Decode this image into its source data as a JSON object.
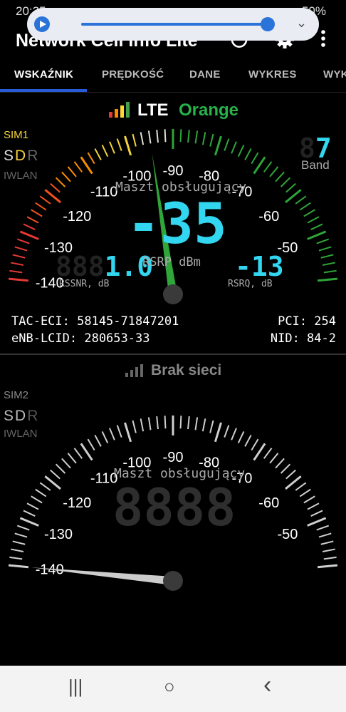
{
  "status": {
    "time": "20:25",
    "battery": "50%"
  },
  "app": {
    "title": "Network Cell Info Lite"
  },
  "icons": {
    "power": "power-icon",
    "settings": "gear-icon",
    "more": "more-vert-icon"
  },
  "tabs": [
    {
      "label": "WSKAŹNIK",
      "active": true
    },
    {
      "label": "PRĘDKOŚĆ",
      "active": false
    },
    {
      "label": "DANE",
      "active": false
    },
    {
      "label": "WYKRES",
      "active": false
    },
    {
      "label": "WYK",
      "active": false
    }
  ],
  "sim1": {
    "tech": "LTE",
    "operator": "Orange",
    "label": "SIM1",
    "sdr": [
      "S",
      "D",
      "R"
    ],
    "iwlan": "IWLAN",
    "band_value": "7",
    "band_label": "Band",
    "gauge_title": "Maszt obsługujący",
    "main_value": "-35",
    "rssnr_value": "1.0",
    "rssnr_label": "RSSNR, dB",
    "rsrp_label": "RSRP dBm",
    "rsrq_value": "-13",
    "rsrq_label": "RSRQ, dB",
    "ticks": [
      "-140",
      "-130",
      "-120",
      "-110",
      "-100",
      "-90",
      "-80",
      "-70",
      "-60",
      "-50"
    ],
    "needle_dbm": -95,
    "tac_eci": "TAC-ECI: 58145-71847201",
    "enb_lcid": "eNB-LCID: 280653-33",
    "pci": "PCI: 254",
    "nid": "NID: 84-2"
  },
  "sim2": {
    "status": "Brak sieci",
    "label": "SIM2",
    "sdr": [
      "S",
      "D",
      "R"
    ],
    "iwlan": "IWLAN",
    "gauge_title": "Maszt obsługujący",
    "ticks": [
      "-140",
      "-130",
      "-120",
      "-110",
      "-100",
      "-90",
      "-80",
      "-70",
      "-60",
      "-50"
    ],
    "needle_dbm": -140
  },
  "navbar": {
    "recent": "|||",
    "home": "○",
    "back": "‹"
  }
}
